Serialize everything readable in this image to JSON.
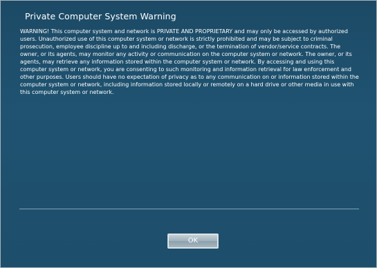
{
  "dialog": {
    "title": "Private Computer System Warning",
    "message": "WARNING! This computer system and network is PRIVATE AND PROPRIETARY and may only be accessed by authorized users. Unauthorized use of this computer system or network is strictly prohibited and may be subject to criminal prosecution, employee discipline up to and including discharge, or the termination of vendor/service contracts. The owner, or its agents, may monitor any activity or communication on the computer system or network. The owner, or its agents, may retrieve any information stored within the computer system or network. By accessing and using this computer system or network, you are consenting to such monitoring and information retrieval for law enforcement and other purposes. Users should have no expectation of privacy as to any communication on or information stored within the computer system or network, including information stored locally or remotely on a hard drive or other media in use with this computer system or network.",
    "ok_label": "OK"
  }
}
